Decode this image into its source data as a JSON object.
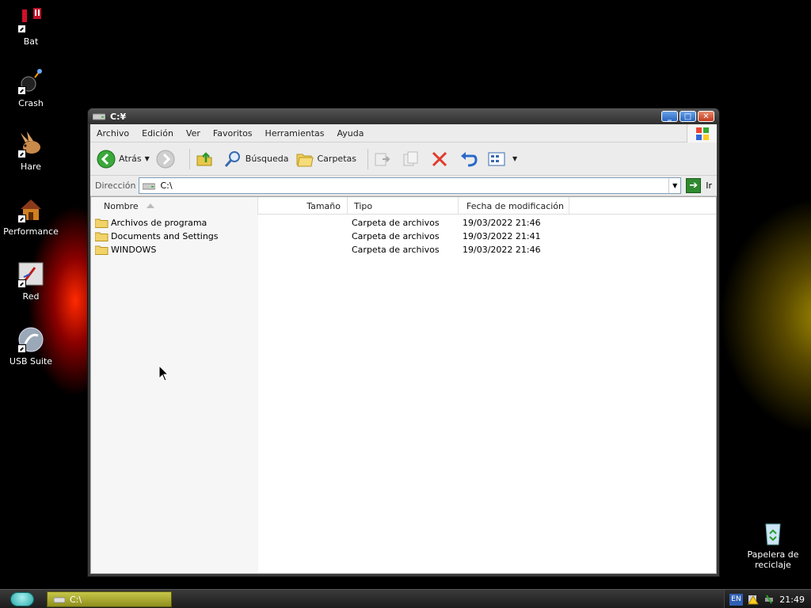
{
  "desktop": {
    "icons": [
      {
        "label": "Bat",
        "icon": "bat-icon"
      },
      {
        "label": "Crash",
        "icon": "crash-icon"
      },
      {
        "label": "Hare",
        "icon": "hare-icon"
      },
      {
        "label": "Performance",
        "icon": "performance-icon"
      },
      {
        "label": "Red",
        "icon": "red-icon"
      },
      {
        "label": "USB Suite",
        "icon": "usb-suite-icon"
      }
    ],
    "recycle_bin": {
      "label_line1": "Papelera de",
      "label_line2": "reciclaje"
    }
  },
  "window": {
    "title": "C:¥",
    "menu": [
      "Archivo",
      "Edición",
      "Ver",
      "Favoritos",
      "Herramientas",
      "Ayuda"
    ],
    "toolbar": {
      "back": "Atrás",
      "search": "Búsqueda",
      "folders": "Carpetas"
    },
    "address": {
      "label": "Dirección",
      "value": "C:\\",
      "go": "Ir"
    },
    "columns": [
      "Nombre",
      "Tamaño",
      "Tipo",
      "Fecha de modificación"
    ],
    "files": [
      {
        "name": "Archivos de programa",
        "size": "",
        "type": "Carpeta de archivos",
        "date": "19/03/2022 21:46"
      },
      {
        "name": "Documents and Settings",
        "size": "",
        "type": "Carpeta de archivos",
        "date": "19/03/2022 21:41"
      },
      {
        "name": "WINDOWS",
        "size": "",
        "type": "Carpeta de archivos",
        "date": "19/03/2022 21:46"
      }
    ]
  },
  "taskbar": {
    "task_label": "C:\\",
    "lang": "EN",
    "clock": "21:49"
  },
  "colors": {
    "task_button": "#a8a832",
    "accent_green": "#2f8a2f",
    "close_red": "#c1391b"
  }
}
